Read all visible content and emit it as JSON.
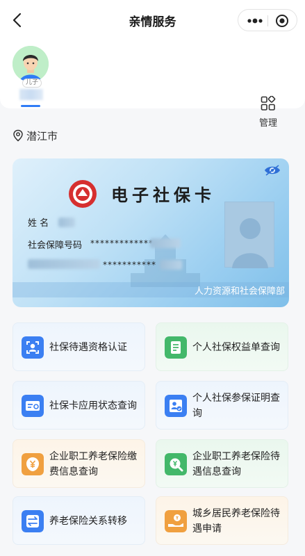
{
  "nav": {
    "title": "亲情服务"
  },
  "member": {
    "relation": "儿子"
  },
  "manage": {
    "label": "管理"
  },
  "location": {
    "city": "潜江市"
  },
  "card": {
    "title": "电子社保卡",
    "name_label": "姓 名",
    "number_label": "社会保障号码",
    "number_mask": "*************",
    "second_mask": "***********",
    "issuer": "人力资源和社会保障部"
  },
  "services": [
    {
      "label": "社保待遇资格认证",
      "icon": "face-verify-icon"
    },
    {
      "label": "个人社保权益单查询",
      "icon": "document-icon"
    },
    {
      "label": "社保卡应用状态查询",
      "icon": "card-icon"
    },
    {
      "label": "个人社保参保证明查询",
      "icon": "person-certificate-icon"
    },
    {
      "label": "企业职工养老保险缴费信息查询",
      "icon": "yuan-icon"
    },
    {
      "label": "企业职工养老保险待遇信息查询",
      "icon": "search-yuan-icon"
    },
    {
      "label": "养老保险关系转移",
      "icon": "transfer-icon"
    },
    {
      "label": "城乡居民养老保险待遇申请",
      "icon": "hand-coin-icon"
    }
  ],
  "colors": {
    "accent": "#2f7cf6",
    "icon_blue": "#3b7ff2",
    "icon_green": "#43b86a",
    "icon_orange": "#f0a040"
  }
}
